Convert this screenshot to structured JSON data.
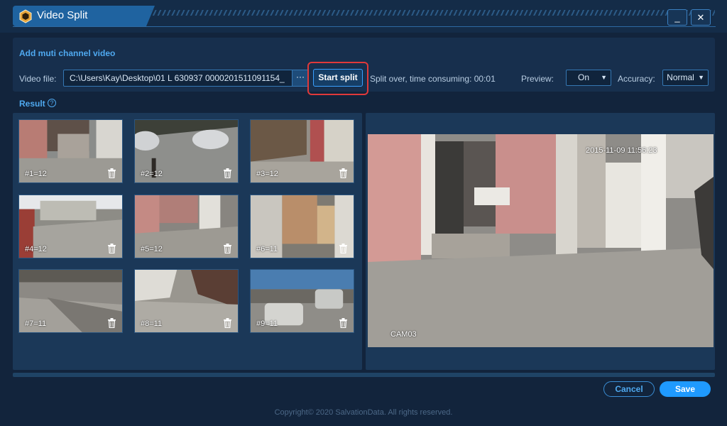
{
  "window": {
    "title": "Video Split",
    "minimize_label": "_",
    "close_label": "✕"
  },
  "section": {
    "title": "Add muti channel video"
  },
  "file": {
    "label": "Video file:",
    "value": "C:\\Users\\Kay\\Desktop\\01 L 630937 0000201511091154_",
    "browse_label": "···"
  },
  "actions": {
    "start_split_label": "Start split"
  },
  "status": {
    "text": "Split over, time consuming: 00:01"
  },
  "preview_setting": {
    "label": "Preview:",
    "value": "On"
  },
  "accuracy_setting": {
    "label": "Accuracy:",
    "value": "Normal"
  },
  "result": {
    "label": "Result",
    "help_icon": "question-circle-icon",
    "items": [
      {
        "label": "#1=12"
      },
      {
        "label": "#2=12"
      },
      {
        "label": "#3=12"
      },
      {
        "label": "#4=12"
      },
      {
        "label": "#5=12"
      },
      {
        "label": "#6=11"
      },
      {
        "label": "#7=11"
      },
      {
        "label": "#8=11"
      },
      {
        "label": "#9=11"
      }
    ]
  },
  "player": {
    "timestamp": "2015-11-09 11:56:23",
    "camera": "CAM03"
  },
  "footer": {
    "cancel_label": "Cancel",
    "save_label": "Save",
    "copyright": "Copyright© 2020 SalvationData. All rights reserved."
  },
  "colors": {
    "accent": "#1f9aff",
    "highlight": "#e0393a",
    "background": "#12243c"
  }
}
